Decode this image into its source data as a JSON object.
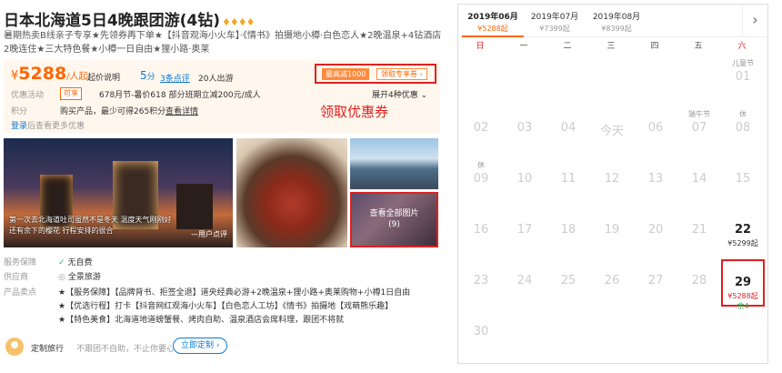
{
  "header": {
    "title": "日本北海道5日4晚跟团游(4钻)",
    "diamonds": "♦♦♦♦",
    "subtitle": "暑期热卖B线亲子专享★先领券再下单★【抖音观海小火车】·《情书》拍摄地小樽·白色恋人★2晚温泉+4钻酒店2晚连住★三大特色餐★小樽一日自由★狸小路·奥莱"
  },
  "price": {
    "currency": "¥",
    "amount": "5288",
    "unit": "/人起",
    "info_link": "起价说明",
    "score": "5",
    "score_unit": "分",
    "reviews": "3条点评",
    "travelers": "20人出游",
    "coupon_tag": "最高减1000",
    "coupon_button": "领取专享券 ›",
    "promo_label": "优惠活动",
    "promo_tag": "可享",
    "promo_text": "678月节-暑价618 部分班期立减200元/成人",
    "promo_expand": "展开4种优惠 ⌄",
    "points_label": "积分",
    "points_text": "购买产品，最少可得265积分",
    "points_link": "查看详情",
    "coupon_annotation": "领取优惠券",
    "login_link": "登录",
    "login_text": "后查看更多优惠"
  },
  "photos": {
    "main_caption": "第一次去北海道吐司虽然不是冬天 温度天气刚刚好 还有余下的樱花 行程安排的很合",
    "main_user": "—用户点评",
    "more_label": "查看全部图片",
    "more_count": "(9)"
  },
  "features": {
    "guarantee_label": "服务保障",
    "guarantee_value": "无自费",
    "supplier_label": "供应商",
    "supplier_value": "全景旅游",
    "highlights_label": "产品卖点",
    "highlights": [
      "★【服务保障】【品牌背书、拒签全退】道央经典必游+2晚温泉+狸小路+奥莱购物+小樽1日自由",
      "★【优选行程】打卡【抖音网红观海小火车】【白色恋人工坊】《情书》拍摄地【戏萌熊乐趣】",
      "★【特色美食】北海道地道螃蟹餐、烤肉自助、温泉酒店会席料理，跟团不将就"
    ]
  },
  "guide": {
    "title": "定制旅行",
    "subtitle": "不跟团不自助，不止你要心",
    "button": "立即定制 ›"
  },
  "calendar": {
    "months": [
      {
        "month": "2019年06月",
        "price": "¥5288起"
      },
      {
        "month": "2019年07月",
        "price": "¥7399起"
      },
      {
        "month": "2019年08月",
        "price": "¥8399起"
      }
    ],
    "next_icon": "›",
    "weekdays": [
      "日",
      "一",
      "二",
      "三",
      "四",
      "五",
      "六"
    ],
    "holidays": {
      "jul1": "儿童节",
      "dragon": "端午节",
      "rest": "休"
    },
    "days": [
      {
        "n": "01",
        "hol": "儿童节"
      },
      {
        "n": "02"
      },
      {
        "n": "03"
      },
      {
        "n": "04"
      },
      {
        "n": "今天"
      },
      {
        "n": "06"
      },
      {
        "n": "07",
        "hol": "端午节"
      },
      {
        "n": "08",
        "hol": "休"
      },
      {
        "n": "09",
        "hol": "休"
      },
      {
        "n": "10"
      },
      {
        "n": "11"
      },
      {
        "n": "12"
      },
      {
        "n": "13"
      },
      {
        "n": "14"
      },
      {
        "n": "15"
      },
      {
        "n": "16"
      },
      {
        "n": "17"
      },
      {
        "n": "18"
      },
      {
        "n": "19"
      },
      {
        "n": "20"
      },
      {
        "n": "21"
      },
      {
        "n": "22",
        "price": "¥5299起"
      },
      {
        "n": "23"
      },
      {
        "n": "24"
      },
      {
        "n": "25"
      },
      {
        "n": "26"
      },
      {
        "n": "27"
      },
      {
        "n": "28"
      },
      {
        "n": "29",
        "price": "¥5288起",
        "remain": "余4"
      },
      {
        "n": "30"
      }
    ],
    "colors": {
      "accent": "#ff6600",
      "highlight": "#e02020",
      "available": "#2fb45a"
    }
  }
}
